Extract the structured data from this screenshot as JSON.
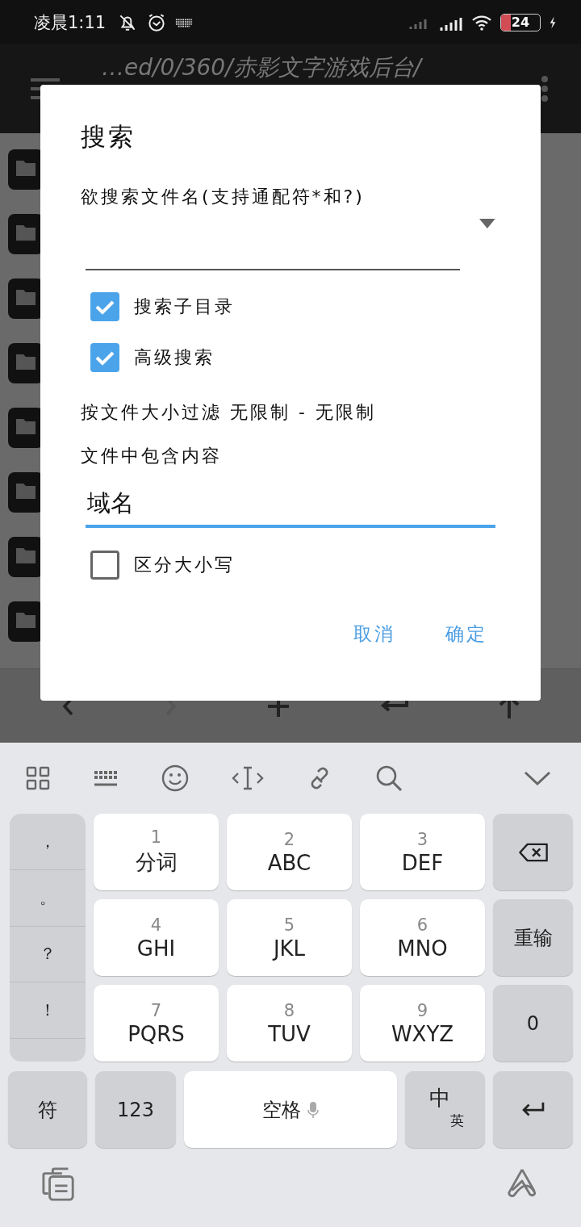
{
  "status_bar": {
    "time": "凌晨1:11",
    "battery": "24"
  },
  "app_bar": {
    "path": "…ed/0/360/赤影文字游戏后台/"
  },
  "dialog": {
    "title": "搜索",
    "filename_label": "欲搜索文件名(支持通配符*和?)",
    "options": [
      {
        "label": "搜索子目录",
        "checked": true
      },
      {
        "label": "高级搜索",
        "checked": true
      }
    ],
    "size_filter": "按文件大小过滤 无限制 - 无限制",
    "content_label": "文件中包含内容",
    "content_field": {
      "value": "域名",
      "focused": true
    },
    "case_option": {
      "label": "区分大小写",
      "checked": false
    },
    "buttons": [
      "取消",
      "确定"
    ]
  },
  "keyboard": {
    "punctuation": [
      "，",
      "。",
      "？",
      "！"
    ],
    "keys": [
      {
        "digit": "1",
        "letters": "分词"
      },
      {
        "digit": "2",
        "letters": "ABC"
      },
      {
        "digit": "3",
        "letters": "DEF"
      },
      {
        "digit": "4",
        "letters": "GHI"
      },
      {
        "digit": "5",
        "letters": "JKL"
      },
      {
        "digit": "6",
        "letters": "MNO"
      },
      {
        "digit": "7",
        "letters": "PQRS"
      },
      {
        "digit": "8",
        "letters": "TUV"
      },
      {
        "digit": "9",
        "letters": "WXYZ"
      }
    ],
    "retype": "重输",
    "zero": "0",
    "symbols": "符",
    "numbers": "123",
    "space": "空格",
    "lang_main": "中",
    "lang_alt": "英"
  }
}
